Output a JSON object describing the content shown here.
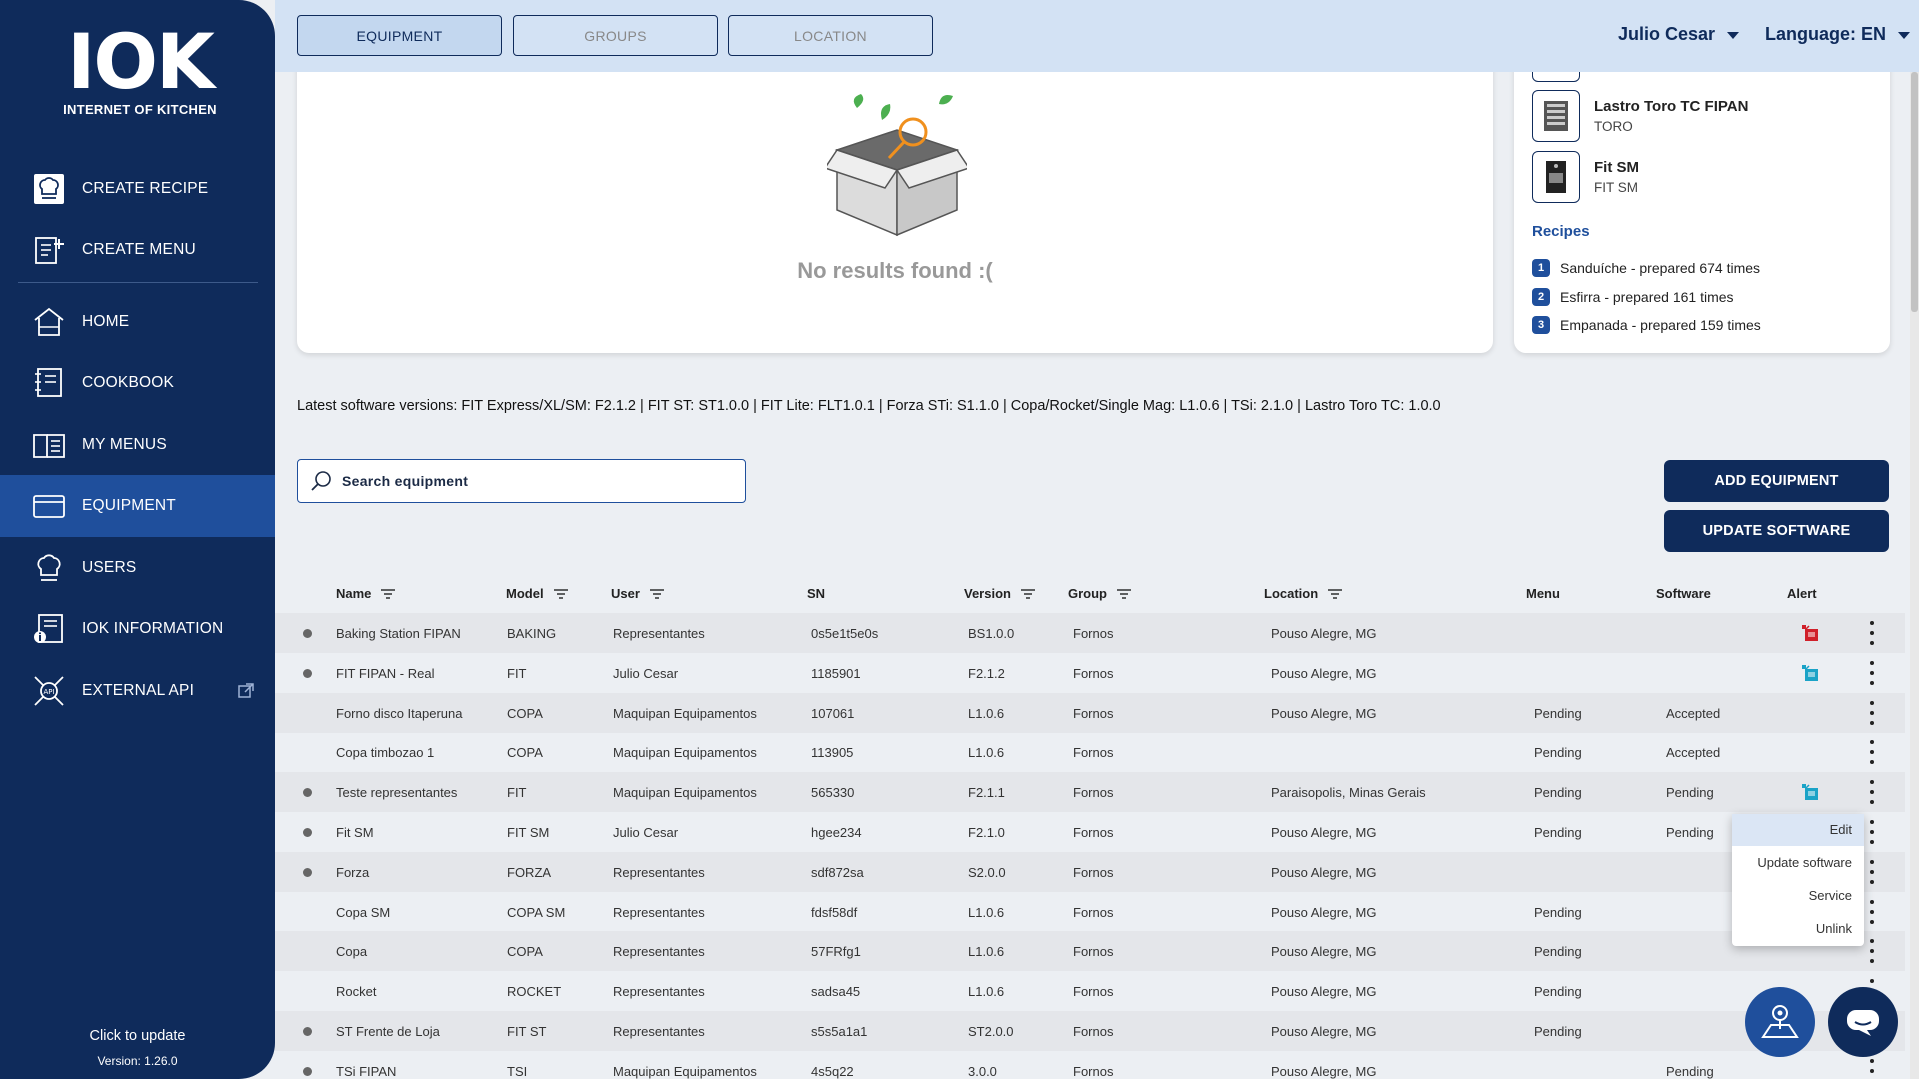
{
  "sidebar": {
    "logo_big": "IOK",
    "logo_sub": "INTERNET OF KITCHEN",
    "items": [
      {
        "label": "CREATE RECIPE",
        "icon": "chef-hat-icon"
      },
      {
        "label": "CREATE MENU",
        "icon": "menu-add-icon"
      },
      {
        "label": "HOME",
        "icon": "home-icon"
      },
      {
        "label": "COOKBOOK",
        "icon": "cookbook-icon"
      },
      {
        "label": "MY MENUS",
        "icon": "my-menus-icon"
      },
      {
        "label": "EQUIPMENT",
        "icon": "equipment-icon",
        "active": true
      },
      {
        "label": "USERS",
        "icon": "users-icon"
      },
      {
        "label": "IOK INFORMATION",
        "icon": "info-icon"
      },
      {
        "label": "EXTERNAL API",
        "icon": "api-icon"
      }
    ],
    "update_link": "Click to update",
    "version": "Version: 1.26.0"
  },
  "topbar": {
    "tabs": [
      {
        "label": "EQUIPMENT",
        "active": true
      },
      {
        "label": "GROUPS"
      },
      {
        "label": "LOCATION"
      }
    ],
    "user": "Julio Cesar",
    "language": "Language: EN"
  },
  "empty_state": {
    "text": "No results found :("
  },
  "side_panel": {
    "equipment": [
      {
        "name": "Lastro Toro TC FIPAN",
        "brand": "TORO"
      },
      {
        "name": "Fit SM",
        "brand": "FIT SM"
      }
    ],
    "recipes_title": "Recipes",
    "recipes": [
      {
        "num": "1",
        "text": "Sanduíche - prepared 674 times"
      },
      {
        "num": "2",
        "text": "Esfirra - prepared 161 times"
      },
      {
        "num": "3",
        "text": "Empanada - prepared 159 times"
      }
    ]
  },
  "software_versions": "Latest software versions: FIT Express/XL/SM: F2.1.2 | FIT ST: ST1.0.0 | FIT Lite: FLT1.0.1 | Forza STi: S1.1.0 | Copa/Rocket/Single Mag: L1.0.6 | TSi: 2.1.0 | Lastro Toro TC: 1.0.0",
  "search": {
    "placeholder": "Search equipment"
  },
  "buttons": {
    "add": "ADD EQUIPMENT",
    "update": "UPDATE SOFTWARE"
  },
  "table": {
    "headers": {
      "name": "Name",
      "model": "Model",
      "user": "User",
      "sn": "SN",
      "version": "Version",
      "group": "Group",
      "location": "Location",
      "menu": "Menu",
      "software": "Software",
      "alert": "Alert"
    },
    "rows": [
      {
        "dot": true,
        "name": "Baking Station FIPAN",
        "model": "BAKING",
        "user": "Representantes",
        "sn": "0s5e1t5e0s",
        "version": "BS1.0.0",
        "group": "Fornos",
        "location": "Pouso Alegre, MG",
        "menu": "",
        "software": "",
        "alert": "red"
      },
      {
        "dot": true,
        "name": "FIT FIPAN - Real",
        "model": "FIT",
        "user": "Julio Cesar",
        "sn": "1185901",
        "version": "F2.1.2",
        "group": "Fornos",
        "location": "Pouso Alegre, MG",
        "menu": "",
        "software": "",
        "alert": "cyan"
      },
      {
        "dot": false,
        "name": "Forno disco Itaperuna",
        "model": "COPA",
        "user": "Maquipan Equipamentos",
        "sn": "107061",
        "version": "L1.0.6",
        "group": "Fornos",
        "location": "Pouso Alegre, MG",
        "menu": "Pending",
        "software": "Accepted",
        "alert": ""
      },
      {
        "dot": false,
        "name": "Copa timbozao 1",
        "model": "COPA",
        "user": "Maquipan Equipamentos",
        "sn": "113905",
        "version": "L1.0.6",
        "group": "Fornos",
        "location": "",
        "menu": "Pending",
        "software": "Accepted",
        "alert": ""
      },
      {
        "dot": true,
        "name": "Teste representantes",
        "model": "FIT",
        "user": "Maquipan Equipamentos",
        "sn": "565330",
        "version": "F2.1.1",
        "group": "Fornos",
        "location": "Paraisopolis, Minas Gerais",
        "menu": "Pending",
        "software": "Pending",
        "alert": "cyan"
      },
      {
        "dot": true,
        "name": "Fit SM",
        "model": "FIT SM",
        "user": "Julio Cesar",
        "sn": "hgee234",
        "version": "F2.1.0",
        "group": "Fornos",
        "location": "Pouso Alegre, MG",
        "menu": "Pending",
        "software": "Pending",
        "alert": ""
      },
      {
        "dot": true,
        "name": "Forza",
        "model": "FORZA",
        "user": "Representantes",
        "sn": "sdf872sa",
        "version": "S2.0.0",
        "group": "Fornos",
        "location": "Pouso Alegre, MG",
        "menu": "",
        "software": "",
        "alert": ""
      },
      {
        "dot": false,
        "name": "Copa SM",
        "model": "COPA SM",
        "user": "Representantes",
        "sn": "fdsf58df",
        "version": "L1.0.6",
        "group": "Fornos",
        "location": "Pouso Alegre, MG",
        "menu": "Pending",
        "software": "",
        "alert": ""
      },
      {
        "dot": false,
        "name": "Copa",
        "model": "COPA",
        "user": "Representantes",
        "sn": "57FRfg1",
        "version": "L1.0.6",
        "group": "Fornos",
        "location": "Pouso Alegre, MG",
        "menu": "Pending",
        "software": "",
        "alert": ""
      },
      {
        "dot": false,
        "name": "Rocket",
        "model": "ROCKET",
        "user": "Representantes",
        "sn": "sadsa45",
        "version": "L1.0.6",
        "group": "Fornos",
        "location": "Pouso Alegre, MG",
        "menu": "Pending",
        "software": "",
        "alert": ""
      },
      {
        "dot": true,
        "name": "ST Frente de Loja",
        "model": "FIT ST",
        "user": "Representantes",
        "sn": "s5s5a1a1",
        "version": "ST2.0.0",
        "group": "Fornos",
        "location": "Pouso Alegre, MG",
        "menu": "Pending",
        "software": "",
        "alert": ""
      },
      {
        "dot": true,
        "name": "TSi FIPAN",
        "model": "TSI",
        "user": "Maquipan Equipamentos",
        "sn": "4s5q22",
        "version": "3.0.0",
        "group": "Fornos",
        "location": "Pouso Alegre, MG",
        "menu": "",
        "software": "Pending",
        "alert": ""
      }
    ]
  },
  "context_menu": {
    "items": [
      "Edit",
      "Update software",
      "Service",
      "Unlink"
    ]
  },
  "colors": {
    "sidebar": "#0f2b5b",
    "active": "#1f4f9c",
    "alert_red": "#d0202a",
    "alert_cyan": "#1aa3c7"
  }
}
